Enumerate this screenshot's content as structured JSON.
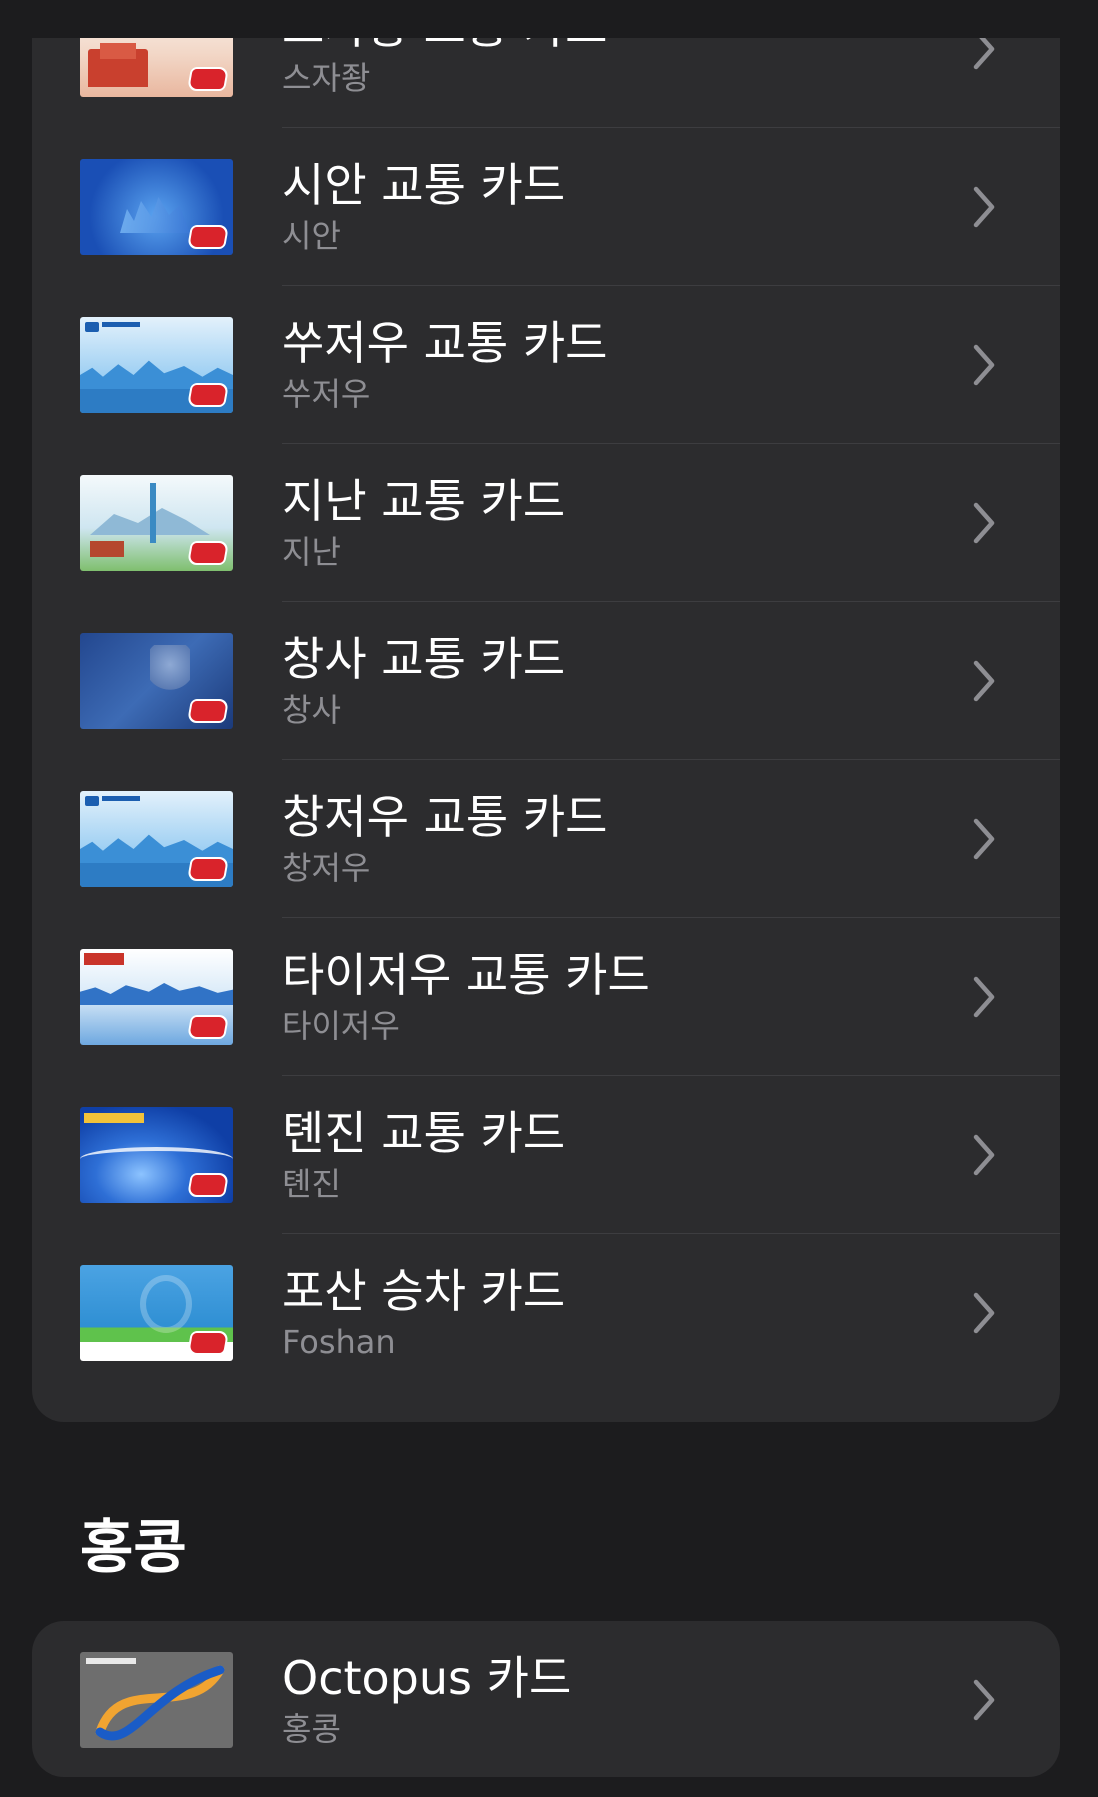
{
  "china_cards": [
    {
      "title": "스자좡 교통 카드",
      "subtitle": "스자좡",
      "art": "shijiazhuang-card-art",
      "colors": [
        "#f6e8df",
        "#e04a3a"
      ]
    },
    {
      "title": "시안 교통 카드",
      "subtitle": "시안",
      "art": "xian-card-art",
      "colors": [
        "#1a4fb5",
        "#3f8ee6"
      ]
    },
    {
      "title": "쑤저우 교통 카드",
      "subtitle": "쑤저우",
      "art": "suzhou-card-art",
      "colors": [
        "#bfe0f7",
        "#3b8fd6"
      ]
    },
    {
      "title": "지난 교통 카드",
      "subtitle": "지난",
      "art": "jinan-card-art",
      "colors": [
        "#e9f3f7",
        "#3a8ac3"
      ]
    },
    {
      "title": "창사 교통 카드",
      "subtitle": "창사",
      "art": "changsha-card-art",
      "colors": [
        "#1c3d82",
        "#5f86c4"
      ]
    },
    {
      "title": "창저우 교통 카드",
      "subtitle": "창저우",
      "art": "changzhou-card-art",
      "colors": [
        "#bfe0f7",
        "#3b8fd6"
      ]
    },
    {
      "title": "타이저우 교통 카드",
      "subtitle": "타이저우",
      "art": "taizhou-card-art",
      "colors": [
        "#eaf3fb",
        "#3173c6"
      ]
    },
    {
      "title": "톈진 교통 카드",
      "subtitle": "톈진",
      "art": "tianjin-card-art",
      "colors": [
        "#0f3fa6",
        "#4b8ae8"
      ]
    },
    {
      "title": "포산 승차 카드",
      "subtitle": "Foshan",
      "art": "foshan-card-art",
      "colors": [
        "#2f8fd3",
        "#5fc24c"
      ]
    }
  ],
  "hk_section": {
    "header": "홍콩",
    "cards": [
      {
        "title": "Octopus 카드",
        "subtitle": "홍콩",
        "art": "octopus-card-art",
        "colors": [
          "#6b6b6b",
          "#1a5cc7",
          "#f1a431"
        ]
      }
    ]
  },
  "chevron_icon": "chevron-right-icon",
  "colors": {
    "background": "#1c1c1e",
    "group": "#2c2c2e",
    "secondary_text": "#8e8e93",
    "separator": "#3d3d40"
  }
}
